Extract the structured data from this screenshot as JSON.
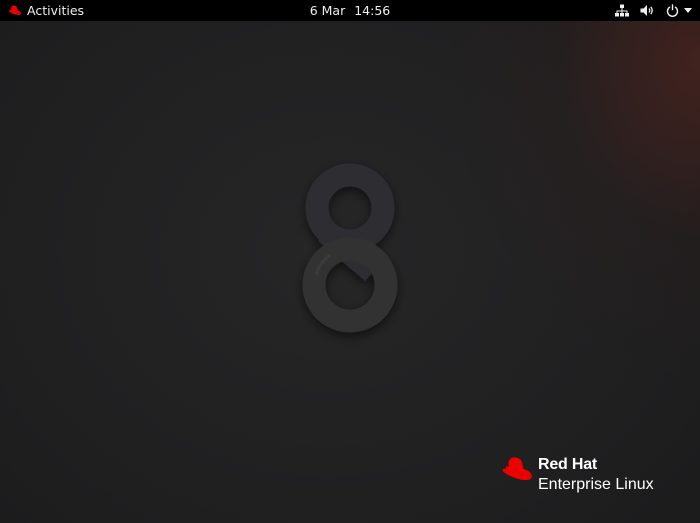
{
  "topbar": {
    "activities_label": "Activities",
    "date": "6 Mar",
    "time": "14:56",
    "status_icons": [
      "network-wired-icon",
      "speaker-volume-icon",
      "power-icon",
      "dropdown-arrow-icon"
    ]
  },
  "desktop": {
    "version_numeral": "8",
    "brand": {
      "name": "Red Hat",
      "product": "Enterprise Linux",
      "logo_color": "#ee0000"
    },
    "background_color": "#1e1e1f",
    "accent_glow_color": "#6e281e"
  }
}
